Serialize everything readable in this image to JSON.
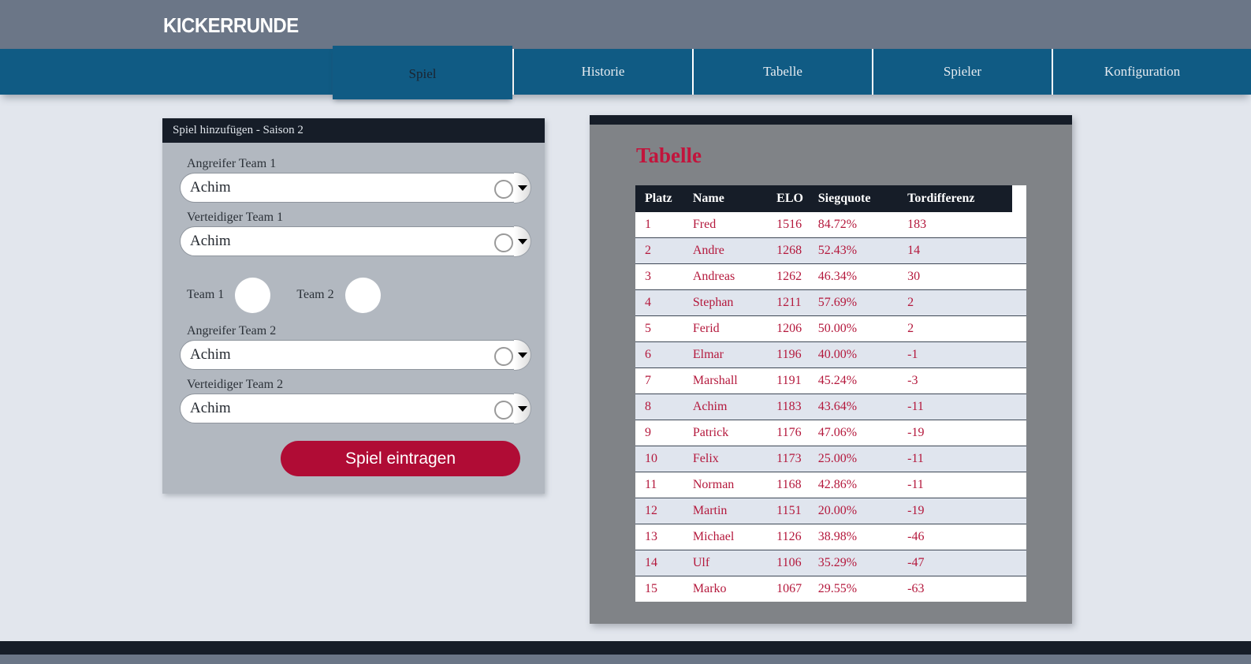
{
  "header": {
    "brand": "KICKERRUNDE"
  },
  "nav": {
    "tabs": [
      {
        "label": "Spiel",
        "active": true
      },
      {
        "label": "Historie",
        "active": false
      },
      {
        "label": "Tabelle",
        "active": false
      },
      {
        "label": "Spieler",
        "active": false
      },
      {
        "label": "Konfiguration",
        "active": false
      }
    ]
  },
  "form": {
    "title": "Spiel hinzufügen - Saison 2",
    "fields": [
      {
        "label": "Angreifer Team 1",
        "value": "Achim"
      },
      {
        "label": "Verteidiger Team 1",
        "value": "Achim"
      }
    ],
    "fields2": [
      {
        "label": "Angreifer Team 2",
        "value": "Achim"
      },
      {
        "label": "Verteidiger Team 2",
        "value": "Achim"
      }
    ],
    "score": {
      "team1_label": "Team 1",
      "team1_value": "",
      "team2_label": "Team 2",
      "team2_value": ""
    },
    "submit_label": "Spiel eintragen"
  },
  "table_panel": {
    "title": "Tabelle",
    "columns": [
      "Platz",
      "Name",
      "ELO",
      "Siegquote",
      "Tordifferenz"
    ],
    "rows": [
      {
        "platz": "1",
        "name": "Fred",
        "elo": "1516",
        "siegquote": "84.72%",
        "tordifferenz": "183"
      },
      {
        "platz": "2",
        "name": "Andre",
        "elo": "1268",
        "siegquote": "52.43%",
        "tordifferenz": "14"
      },
      {
        "platz": "3",
        "name": "Andreas",
        "elo": "1262",
        "siegquote": "46.34%",
        "tordifferenz": "30"
      },
      {
        "platz": "4",
        "name": "Stephan",
        "elo": "1211",
        "siegquote": "57.69%",
        "tordifferenz": "2"
      },
      {
        "platz": "5",
        "name": "Ferid",
        "elo": "1206",
        "siegquote": "50.00%",
        "tordifferenz": "2"
      },
      {
        "platz": "6",
        "name": "Elmar",
        "elo": "1196",
        "siegquote": "40.00%",
        "tordifferenz": "-1"
      },
      {
        "platz": "7",
        "name": "Marshall",
        "elo": "1191",
        "siegquote": "45.24%",
        "tordifferenz": "-3"
      },
      {
        "platz": "8",
        "name": "Achim",
        "elo": "1183",
        "siegquote": "43.64%",
        "tordifferenz": "-11"
      },
      {
        "platz": "9",
        "name": "Patrick",
        "elo": "1176",
        "siegquote": "47.06%",
        "tordifferenz": "-19"
      },
      {
        "platz": "10",
        "name": "Felix",
        "elo": "1173",
        "siegquote": "25.00%",
        "tordifferenz": "-11"
      },
      {
        "platz": "11",
        "name": "Norman",
        "elo": "1168",
        "siegquote": "42.86%",
        "tordifferenz": "-11"
      },
      {
        "platz": "12",
        "name": "Martin",
        "elo": "1151",
        "siegquote": "20.00%",
        "tordifferenz": "-19"
      },
      {
        "platz": "13",
        "name": "Michael",
        "elo": "1126",
        "siegquote": "38.98%",
        "tordifferenz": "-46"
      },
      {
        "platz": "14",
        "name": "Ulf",
        "elo": "1106",
        "siegquote": "35.29%",
        "tordifferenz": "-47"
      },
      {
        "platz": "15",
        "name": "Marko",
        "elo": "1067",
        "siegquote": "29.55%",
        "tordifferenz": "-63"
      }
    ]
  },
  "colors": {
    "header_bg": "#6b7687",
    "nav_bg": "#105b84",
    "page_bg": "#e2e6ed",
    "panel_dark": "#161d28",
    "form_panel_bg": "#b2b8c0",
    "table_panel_bg": "#808387",
    "accent_red": "#b00c35",
    "title_red": "#c2143c"
  }
}
